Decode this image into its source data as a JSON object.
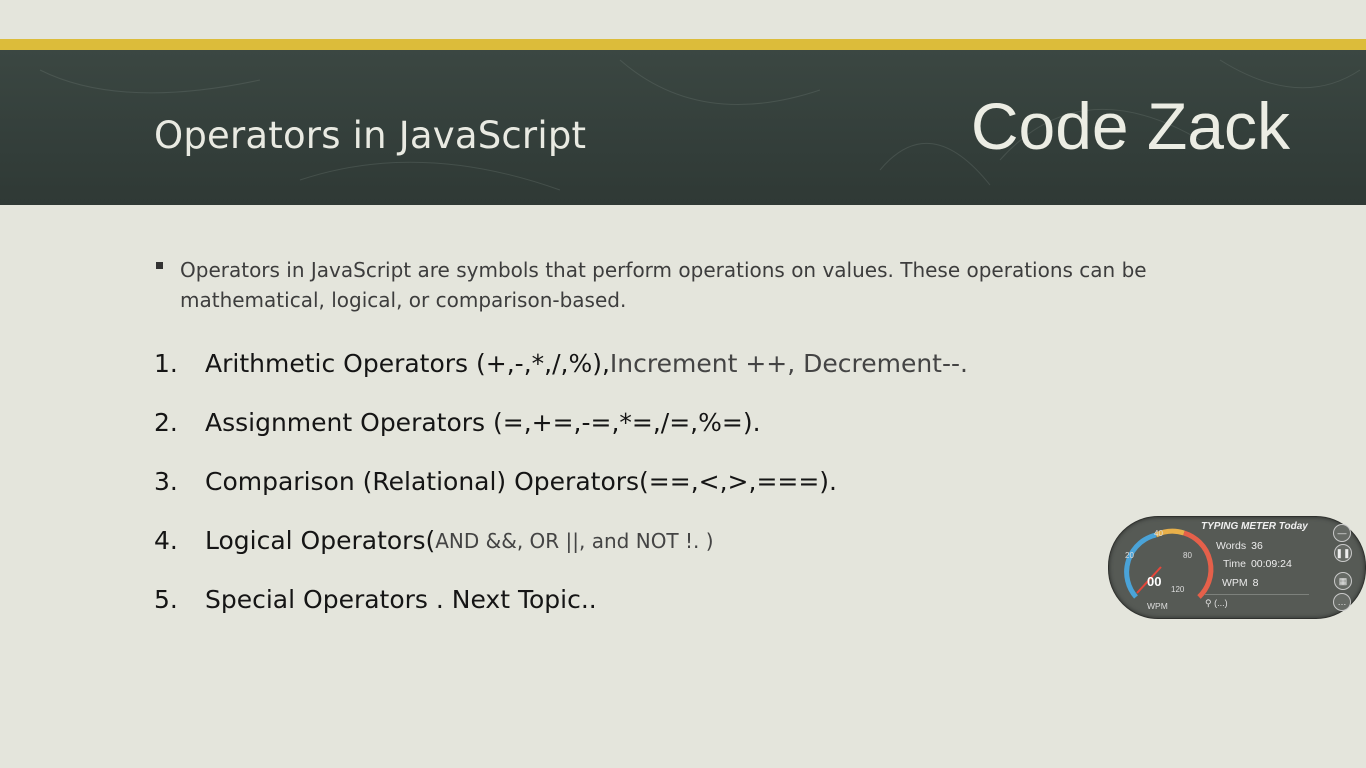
{
  "slide": {
    "title": "Operators in JavaScript",
    "brand": "Code Zack",
    "intro": "Operators in JavaScript are symbols that perform operations on values. These operations can be mathematical, logical, or comparison-based.",
    "items": [
      {
        "num": "1.",
        "main": "Arithmetic Operators (+,-,*,/,%),",
        "extra": " Increment ++, Decrement--."
      },
      {
        "num": "2.",
        "main": "Assignment Operators (=,+=,-=,*=,/=,%=)."
      },
      {
        "num": "3.",
        "main": "Comparison (Relational) Operators(==,<,>,===)."
      },
      {
        "num": "4.",
        "main": "Logical Operators(",
        "extra": "AND &&, OR ||, and NOT !. )"
      },
      {
        "num": "5.",
        "main": "Special Operators . Next Topic.."
      }
    ]
  },
  "typing_meter": {
    "title": "TYPING METER Today",
    "words_label": "Words",
    "words_value": "36",
    "time_label": "Time",
    "time_value": "00:09:24",
    "wpm_label": "WPM",
    "wpm_value": "8",
    "gauge_value": "00",
    "gauge_caption": "WPM",
    "ticks": [
      "20",
      "40",
      "80",
      "120"
    ],
    "search_text": "(...)",
    "icons": [
      "minimize-icon",
      "pause-icon",
      "chart-icon",
      "more-icon",
      "search-icon"
    ]
  },
  "colors": {
    "background": "#e4e5dc",
    "header": "#343f3b",
    "accent_bar": "#dcbc3a"
  }
}
